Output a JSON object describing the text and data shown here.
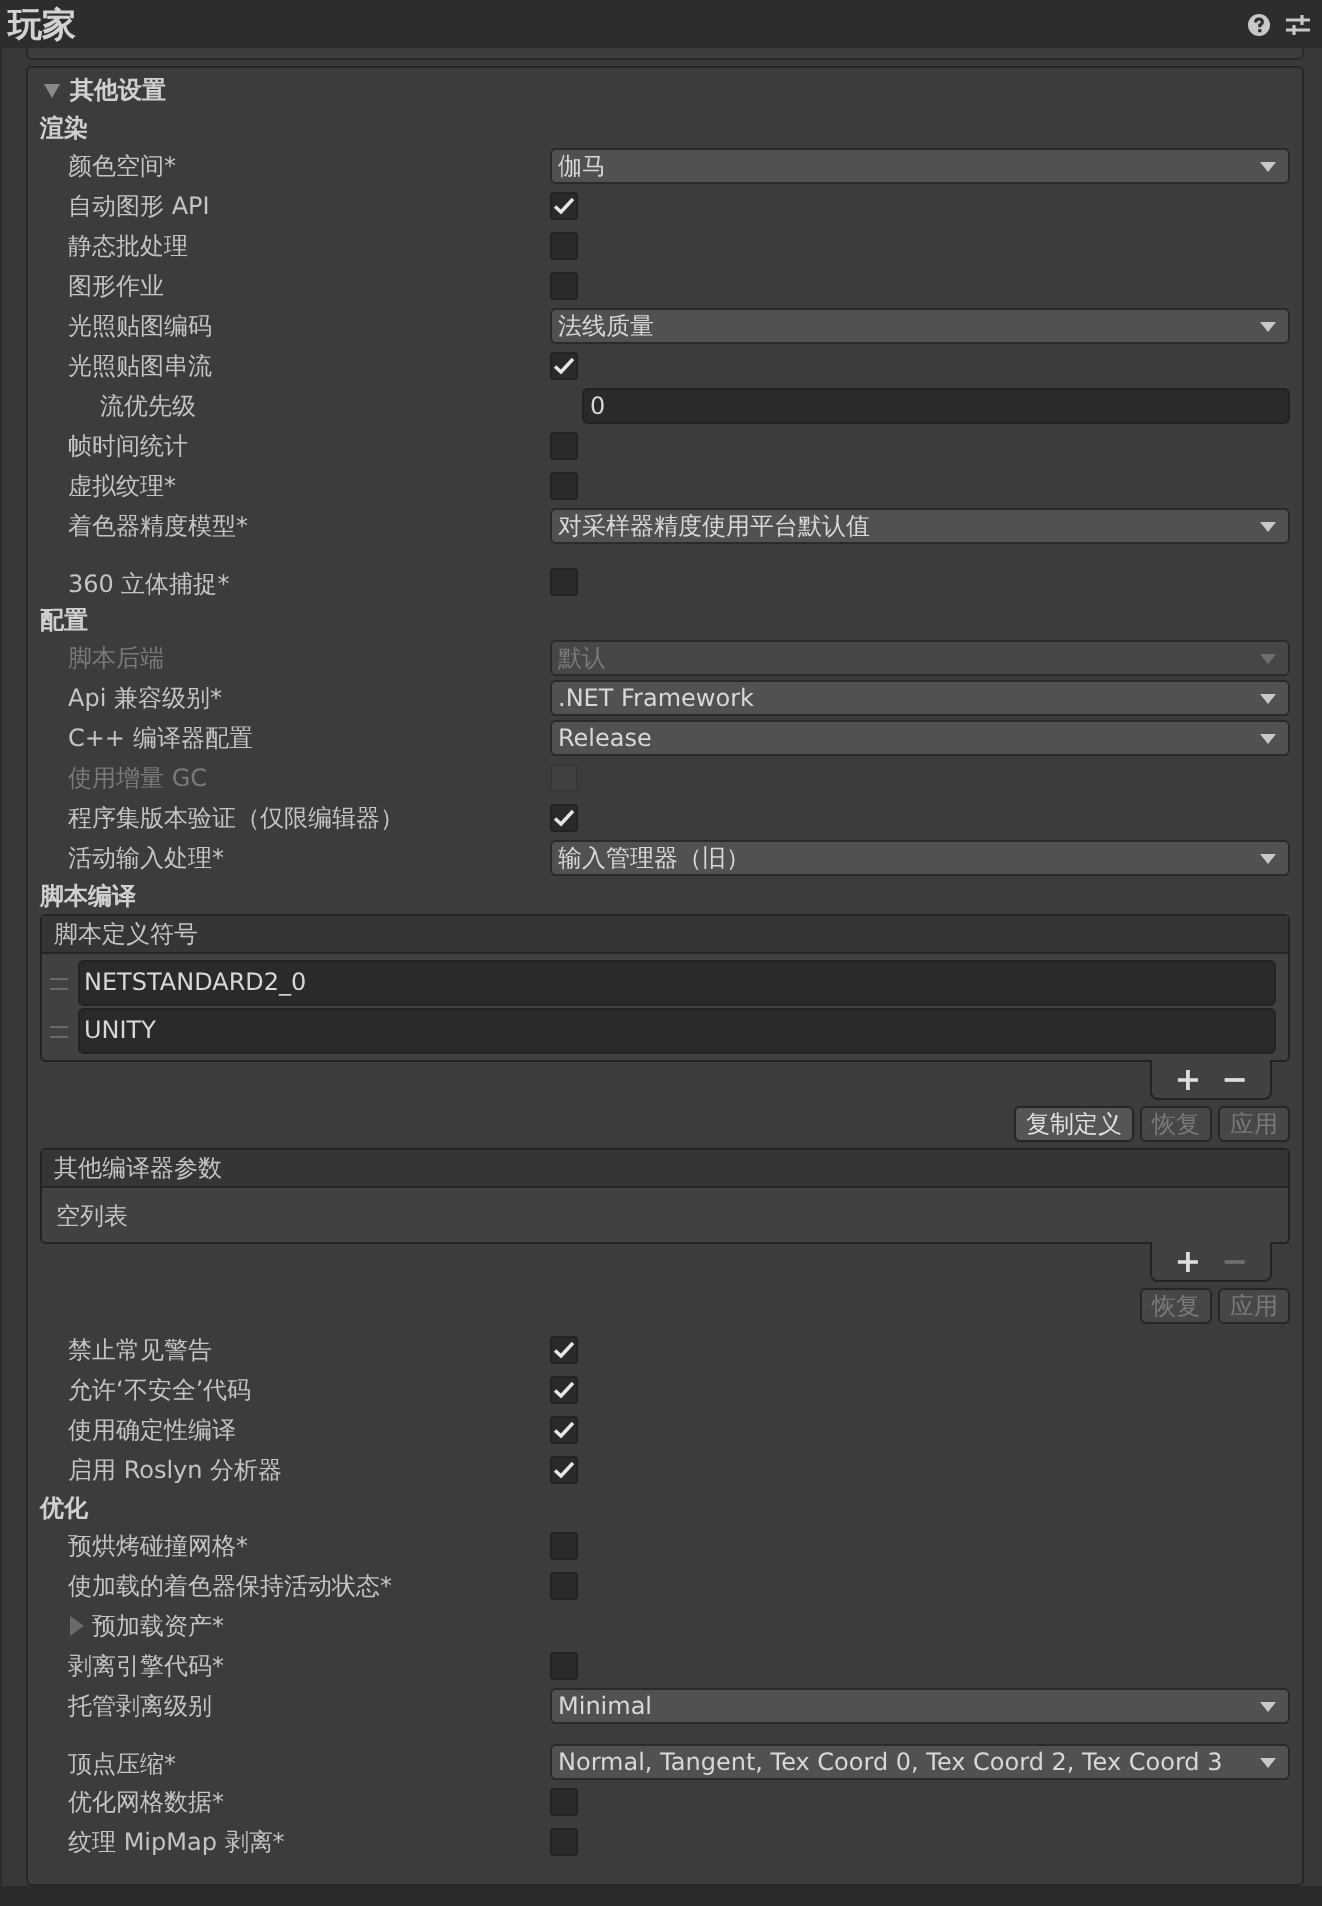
{
  "window": {
    "title": "玩家"
  },
  "header_icons": [
    {
      "kind": "help"
    },
    {
      "kind": "settings"
    }
  ],
  "foldout": {
    "label": "其他设置",
    "expanded": true
  },
  "sections": [
    {
      "title": "渲染",
      "items": [
        {
          "kind": "dropdown",
          "label": "颜色空间*",
          "value": "伽马",
          "disabled": false
        },
        {
          "kind": "checkbox",
          "label": "自动图形 API",
          "checked": true,
          "disabled": false
        },
        {
          "kind": "checkbox",
          "label": "静态批处理",
          "checked": false,
          "disabled": false
        },
        {
          "kind": "checkbox",
          "label": "图形作业",
          "checked": false,
          "disabled": false
        },
        {
          "kind": "dropdown",
          "label": "光照贴图编码",
          "value": "法线质量",
          "disabled": false
        },
        {
          "kind": "checkbox",
          "label": "光照贴图串流",
          "checked": true,
          "disabled": false,
          "children": [
            {
              "kind": "number",
              "label": "流优先级",
              "value": "0",
              "disabled": false
            }
          ]
        },
        {
          "kind": "checkbox",
          "label": "帧时间统计",
          "checked": false,
          "disabled": false
        },
        {
          "kind": "checkbox",
          "label": "虚拟纹理*",
          "checked": false,
          "disabled": false
        },
        {
          "kind": "dropdown",
          "label": "着色器精度模型*",
          "value": "对采样器精度使用平台默认值",
          "disabled": false
        },
        {
          "kind": "checkbox",
          "label": "360 立体捕捉*",
          "checked": false,
          "disabled": false,
          "gap_before": true
        }
      ]
    },
    {
      "title": "配置",
      "items": [
        {
          "kind": "dropdown",
          "label": "脚本后端",
          "value": "默认",
          "disabled": true
        },
        {
          "kind": "dropdown",
          "label": "Api 兼容级别*",
          "value": ".NET Framework",
          "disabled": false
        },
        {
          "kind": "dropdown",
          "label": "C++ 编译器配置",
          "value": "Release",
          "disabled": false
        },
        {
          "kind": "checkbox",
          "label": "使用增量 GC",
          "checked": false,
          "disabled": true
        },
        {
          "kind": "checkbox",
          "label": "程序集版本验证（仅限编辑器）",
          "checked": true,
          "disabled": false
        },
        {
          "kind": "dropdown",
          "label": "活动输入处理*",
          "value": "输入管理器（旧）",
          "disabled": false
        }
      ]
    },
    {
      "title": "脚本编译",
      "items": [
        {
          "kind": "list",
          "header": "脚本定义符号",
          "entries": [
            "NETSTANDARD2_0",
            "UNITY"
          ],
          "add": {
            "label": "+",
            "disabled": false
          },
          "remove": {
            "label": "−",
            "disabled": false
          },
          "buttons": [
            {
              "label": "复制定义",
              "disabled": false
            },
            {
              "label": "恢复",
              "disabled": true
            },
            {
              "label": "应用",
              "disabled": true
            }
          ]
        },
        {
          "kind": "list",
          "header": "其他编译器参数",
          "empty_text": "空列表",
          "add": {
            "label": "+",
            "disabled": false
          },
          "remove": {
            "label": "−",
            "disabled": true
          },
          "buttons": [
            {
              "label": "恢复",
              "disabled": true
            },
            {
              "label": "应用",
              "disabled": true
            }
          ]
        },
        {
          "kind": "checkbox",
          "label": "禁止常见警告",
          "checked": true,
          "disabled": false
        },
        {
          "kind": "checkbox",
          "label": "允许‘不安全’代码",
          "checked": true,
          "disabled": false
        },
        {
          "kind": "checkbox",
          "label": "使用确定性编译",
          "checked": true,
          "disabled": false
        },
        {
          "kind": "checkbox",
          "label": "启用 Roslyn 分析器",
          "checked": true,
          "disabled": false
        }
      ]
    },
    {
      "title": "优化",
      "items": [
        {
          "kind": "checkbox",
          "label": "预烘烤碰撞网格*",
          "checked": false,
          "disabled": false
        },
        {
          "kind": "checkbox",
          "label": "使加载的着色器保持活动状态*",
          "checked": false,
          "disabled": false
        },
        {
          "kind": "foldout",
          "label": "预加载资产*",
          "expanded": false
        },
        {
          "kind": "checkbox",
          "label": "剥离引擎代码*",
          "checked": false,
          "disabled": false
        },
        {
          "kind": "dropdown",
          "label": "托管剥离级别",
          "value": "Minimal",
          "disabled": false
        },
        {
          "kind": "dropdown",
          "label": "顶点压缩*",
          "value": "Normal, Tangent, Tex Coord 0, Tex Coord 2, Tex Coord 3",
          "disabled": false,
          "gap_before": true
        },
        {
          "kind": "checkbox",
          "label": "优化网格数据*",
          "checked": false,
          "disabled": false
        },
        {
          "kind": "checkbox",
          "label": "纹理 MipMap 剥离*",
          "checked": false,
          "disabled": false
        }
      ]
    }
  ]
}
